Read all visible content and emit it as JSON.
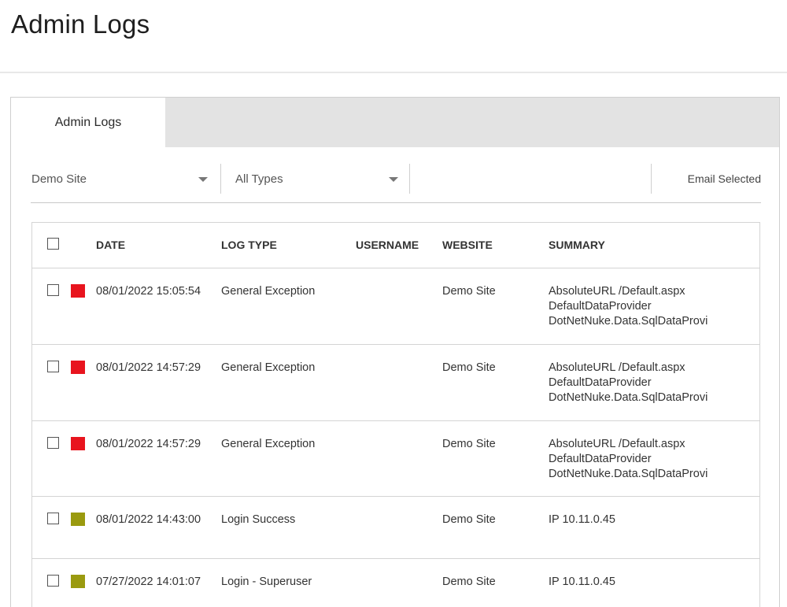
{
  "page": {
    "title": "Admin Logs"
  },
  "tabs": [
    {
      "label": "Admin Logs",
      "active": true
    }
  ],
  "filters": {
    "site": {
      "selected": "Demo Site"
    },
    "types": {
      "selected": "All Types"
    },
    "search": {
      "value": "",
      "placeholder": ""
    },
    "email_label": "Email Selected"
  },
  "table": {
    "headers": {
      "date": "DATE",
      "log_type": "LOG TYPE",
      "username": "USERNAME",
      "website": "WEBSITE",
      "summary": "SUMMARY"
    },
    "rows": [
      {
        "color": "#e8141e",
        "date": "08/01/2022 15:05:54",
        "log_type": "General Exception",
        "username": "",
        "website": "Demo Site",
        "summary": "AbsoluteURL /Default.aspx\nDefaultDataProvider\nDotNetNuke.Data.SqlDataProvi"
      },
      {
        "color": "#e8141e",
        "date": "08/01/2022 14:57:29",
        "log_type": "General Exception",
        "username": "",
        "website": "Demo Site",
        "summary": "AbsoluteURL /Default.aspx\nDefaultDataProvider\nDotNetNuke.Data.SqlDataProvi"
      },
      {
        "color": "#e8141e",
        "date": "08/01/2022 14:57:29",
        "log_type": "General Exception",
        "username": "",
        "website": "Demo Site",
        "summary": "AbsoluteURL /Default.aspx\nDefaultDataProvider\nDotNetNuke.Data.SqlDataProvi"
      },
      {
        "color": "#9a9a0f",
        "date": "08/01/2022 14:43:00",
        "log_type": "Login Success",
        "username": "",
        "website": "Demo Site",
        "summary": "IP 10.11.0.45"
      },
      {
        "color": "#9a9a0f",
        "date": "07/27/2022 14:01:07",
        "log_type": "Login - Superuser",
        "username": "",
        "website": "Demo Site",
        "summary": "IP 10.11.0.45"
      }
    ]
  }
}
